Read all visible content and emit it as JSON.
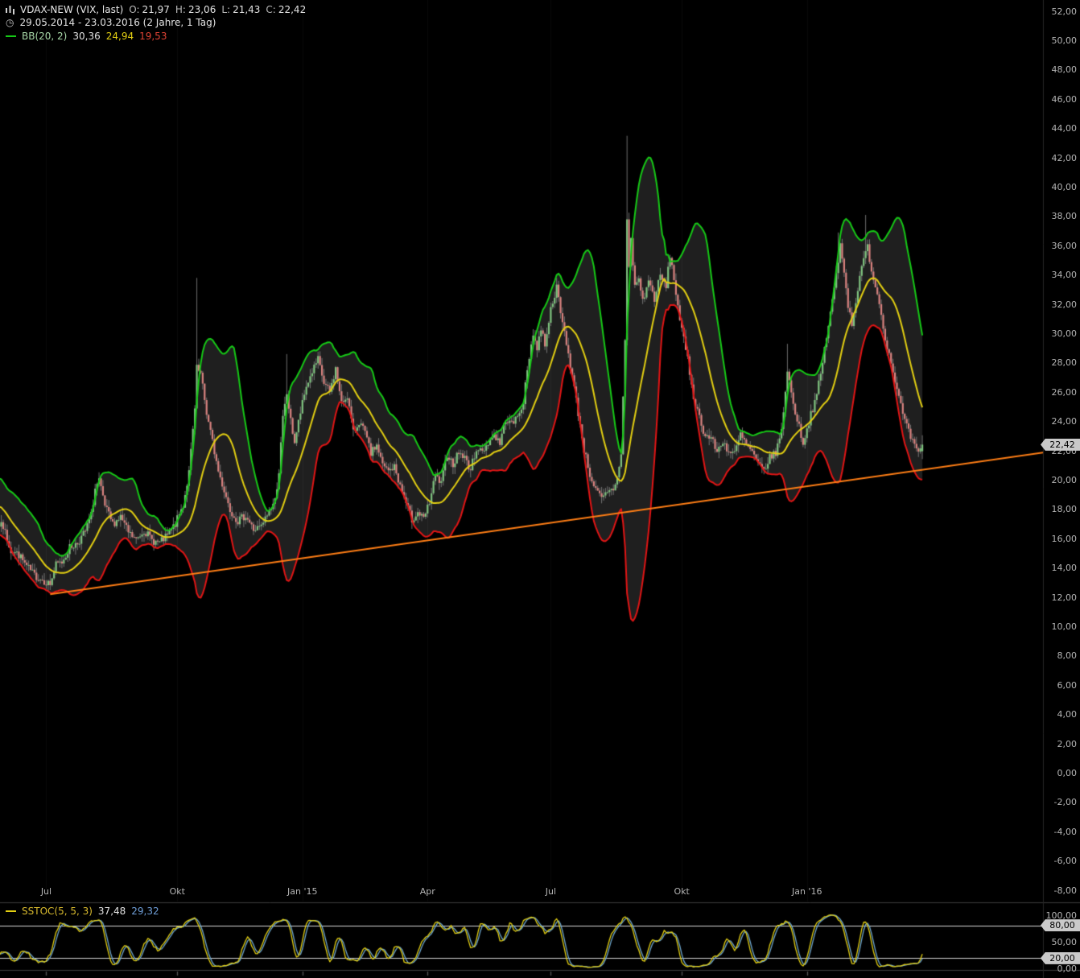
{
  "colors": {
    "background": "#000000",
    "band_fill": "#1f1f1f",
    "grid_line": "rgba(255,255,255,0.04)",
    "bb_upper": "#16c916",
    "bb_middle": "#e3cf12",
    "bb_lower": "#e11515",
    "trendline": "#ff7e15",
    "candle_up": "#7fc47f",
    "candle_down": "#d9827f",
    "wick": "#8a8a8a",
    "axis_text": "#b4b4b4",
    "tag_bg": "#c9c9c9",
    "tag_text": "#000000",
    "stoch_k": "#e3cf12",
    "stoch_d": "#6fa8d0",
    "stoch_level_line": "#d6d6d6",
    "panel_divider": "#3c3c3c"
  },
  "header": {
    "symbol": "VDAX-NEW (VIX, last)",
    "o_label": "O:",
    "o_value": "21,97",
    "h_label": "H:",
    "h_value": "23,06",
    "l_label": "L:",
    "l_value": "21,43",
    "c_label": "C:",
    "c_value": "22,42",
    "date_range": "29.05.2014 - 23.03.2016 (2 Jahre, 1 Tag)",
    "bb_label": "BB(20, 2)",
    "bb_upper_value": "30,36",
    "bb_middle_value": "24,94",
    "bb_lower_value": "19,53"
  },
  "price_axis": {
    "max": 52,
    "min": -8,
    "step": 2,
    "labels": [
      "52,00",
      "50,00",
      "48,00",
      "46,00",
      "44,00",
      "42,00",
      "40,00",
      "38,00",
      "36,00",
      "34,00",
      "32,00",
      "30,00",
      "28,00",
      "26,00",
      "24,00",
      "22,00",
      "20,00",
      "18,00",
      "16,00",
      "14,00",
      "12,00",
      "10,00",
      "8,00",
      "6,00",
      "4,00",
      "2,00",
      "0,00",
      "-2,00",
      "-4,00",
      "-6,00",
      "-8,00"
    ],
    "last_price_tag": "22,42"
  },
  "time_axis": {
    "labels": [
      {
        "text": "Jul",
        "day": 22
      },
      {
        "text": "Okt",
        "day": 89
      },
      {
        "text": "Jan '15",
        "day": 153
      },
      {
        "text": "Apr",
        "day": 217
      },
      {
        "text": "Jul",
        "day": 280
      },
      {
        "text": "Okt",
        "day": 347
      },
      {
        "text": "Jan '16",
        "day": 411
      }
    ]
  },
  "sstoc": {
    "legend_label": "SSTOC(5, 5, 3)",
    "k_value": "37,48",
    "d_value": "29,32",
    "axis_top": "100,00",
    "axis_mid": "50,00",
    "axis_bottom": "0,00",
    "tag_upper": "80,00",
    "tag_lower": "20,00",
    "upper_level": 80,
    "lower_level": 20,
    "period": 5,
    "smooth_k": 5,
    "smooth_d": 3
  },
  "chart_data": {
    "type": "candlestick",
    "title": "VDAX-NEW (VIX, last)",
    "x_start": "29.05.2014",
    "x_end": "23.03.2016",
    "ylim": [
      -8,
      52
    ],
    "total_days": 471,
    "bollinger": {
      "period": 20,
      "stddev": 2
    },
    "trendline": {
      "day1": 24,
      "value1": 12.2,
      "day2": 533,
      "value2": 21.9
    },
    "last_candle": {
      "open": 21.97,
      "high": 23.06,
      "low": 21.43,
      "close": 22.42
    },
    "close_anchors": [
      [
        -20,
        20.0
      ],
      [
        -14,
        18.6
      ],
      [
        -8,
        17.6
      ],
      [
        -3,
        17.0
      ],
      [
        0,
        16.8
      ],
      [
        4,
        15.2
      ],
      [
        8,
        14.9
      ],
      [
        12,
        14.1
      ],
      [
        16,
        13.5
      ],
      [
        20,
        13.2
      ],
      [
        24,
        12.9
      ],
      [
        27,
        14.2
      ],
      [
        30,
        14.4
      ],
      [
        34,
        15.4
      ],
      [
        38,
        15.7
      ],
      [
        42,
        16.5
      ],
      [
        45,
        17.6
      ],
      [
        47,
        19.4
      ],
      [
        49,
        19.9
      ],
      [
        52,
        18.2
      ],
      [
        56,
        17.0
      ],
      [
        60,
        17.5
      ],
      [
        64,
        16.4
      ],
      [
        68,
        15.9
      ],
      [
        72,
        16.6
      ],
      [
        76,
        15.9
      ],
      [
        80,
        15.7
      ],
      [
        84,
        16.2
      ],
      [
        88,
        17.0
      ],
      [
        92,
        18.3
      ],
      [
        95,
        20.5
      ],
      [
        98,
        24.8
      ],
      [
        99,
        27.6
      ],
      [
        101,
        27.2
      ],
      [
        104,
        24.6
      ],
      [
        107,
        22.6
      ],
      [
        110,
        20.6
      ],
      [
        113,
        19.3
      ],
      [
        116,
        18.0
      ],
      [
        120,
        17.2
      ],
      [
        124,
        17.6
      ],
      [
        128,
        16.6
      ],
      [
        132,
        16.8
      ],
      [
        136,
        17.9
      ],
      [
        139,
        18.6
      ],
      [
        141,
        20.6
      ],
      [
        143,
        24.2
      ],
      [
        145,
        25.9
      ],
      [
        147,
        24.0
      ],
      [
        149,
        22.6
      ],
      [
        152,
        24.6
      ],
      [
        155,
        26.4
      ],
      [
        158,
        27.4
      ],
      [
        161,
        28.2
      ],
      [
        164,
        26.6
      ],
      [
        167,
        26.0
      ],
      [
        170,
        27.6
      ],
      [
        173,
        25.2
      ],
      [
        176,
        25.8
      ],
      [
        179,
        23.2
      ],
      [
        182,
        24.0
      ],
      [
        185,
        23.2
      ],
      [
        188,
        21.8
      ],
      [
        191,
        22.4
      ],
      [
        194,
        21.0
      ],
      [
        197,
        20.6
      ],
      [
        200,
        20.9
      ],
      [
        203,
        19.6
      ],
      [
        206,
        18.4
      ],
      [
        209,
        17.3
      ],
      [
        212,
        17.8
      ],
      [
        215,
        17.3
      ],
      [
        218,
        18.5
      ],
      [
        221,
        20.3
      ],
      [
        224,
        19.7
      ],
      [
        227,
        21.8
      ],
      [
        230,
        21.1
      ],
      [
        233,
        21.9
      ],
      [
        236,
        21.5
      ],
      [
        239,
        20.7
      ],
      [
        242,
        22.2
      ],
      [
        245,
        21.9
      ],
      [
        248,
        22.6
      ],
      [
        251,
        23.1
      ],
      [
        254,
        22.5
      ],
      [
        257,
        24.2
      ],
      [
        260,
        23.8
      ],
      [
        263,
        24.3
      ],
      [
        266,
        25.4
      ],
      [
        269,
        28.4
      ],
      [
        271,
        30.1
      ],
      [
        273,
        28.9
      ],
      [
        275,
        30.4
      ],
      [
        277,
        29.3
      ],
      [
        279,
        30.9
      ],
      [
        281,
        32.3
      ],
      [
        283,
        33.1
      ],
      [
        285,
        31.4
      ],
      [
        288,
        29.4
      ],
      [
        291,
        27.1
      ],
      [
        294,
        24.6
      ],
      [
        297,
        22.1
      ],
      [
        300,
        20.4
      ],
      [
        303,
        19.3
      ],
      [
        306,
        18.7
      ],
      [
        309,
        19.1
      ],
      [
        312,
        19.4
      ],
      [
        314,
        20.1
      ],
      [
        316,
        21.9
      ],
      [
        318,
        29.5
      ],
      [
        319,
        37.7
      ],
      [
        320,
        34.6
      ],
      [
        321,
        36.4
      ],
      [
        323,
        33.2
      ],
      [
        325,
        33.8
      ],
      [
        327,
        32.2
      ],
      [
        330,
        33.6
      ],
      [
        333,
        32.4
      ],
      [
        336,
        33.9
      ],
      [
        339,
        33.2
      ],
      [
        341,
        35.4
      ],
      [
        344,
        32.8
      ],
      [
        347,
        30.2
      ],
      [
        350,
        28.2
      ],
      [
        353,
        25.7
      ],
      [
        356,
        24.3
      ],
      [
        359,
        23.0
      ],
      [
        362,
        22.9
      ],
      [
        365,
        21.9
      ],
      [
        368,
        22.7
      ],
      [
        371,
        21.9
      ],
      [
        374,
        21.8
      ],
      [
        377,
        23.1
      ],
      [
        380,
        22.4
      ],
      [
        383,
        21.9
      ],
      [
        386,
        21.0
      ],
      [
        389,
        20.7
      ],
      [
        392,
        21.5
      ],
      [
        395,
        21.9
      ],
      [
        398,
        23.3
      ],
      [
        400,
        26.2
      ],
      [
        401,
        27.5
      ],
      [
        403,
        25.9
      ],
      [
        406,
        24.1
      ],
      [
        409,
        22.6
      ],
      [
        411,
        23.4
      ],
      [
        413,
        24.6
      ],
      [
        415,
        25.2
      ],
      [
        418,
        27.2
      ],
      [
        421,
        29.8
      ],
      [
        424,
        32.2
      ],
      [
        427,
        34.9
      ],
      [
        428,
        36.1
      ],
      [
        430,
        34.4
      ],
      [
        432,
        31.9
      ],
      [
        434,
        30.7
      ],
      [
        436,
        32.3
      ],
      [
        438,
        33.7
      ],
      [
        440,
        35.1
      ],
      [
        442,
        35.9
      ],
      [
        444,
        34.4
      ],
      [
        446,
        33.2
      ],
      [
        448,
        32.2
      ],
      [
        450,
        30.4
      ],
      [
        452,
        29.2
      ],
      [
        454,
        28.0
      ],
      [
        456,
        26.9
      ],
      [
        458,
        25.6
      ],
      [
        460,
        24.5
      ],
      [
        462,
        23.6
      ],
      [
        464,
        22.9
      ],
      [
        466,
        22.3
      ],
      [
        468,
        21.7
      ],
      [
        470,
        22.42
      ]
    ],
    "high_spikes": [
      [
        99,
        33.8
      ],
      [
        145,
        28.6
      ],
      [
        319,
        43.5
      ],
      [
        401,
        29.3
      ],
      [
        427,
        36.9
      ],
      [
        441,
        38.1
      ]
    ]
  }
}
